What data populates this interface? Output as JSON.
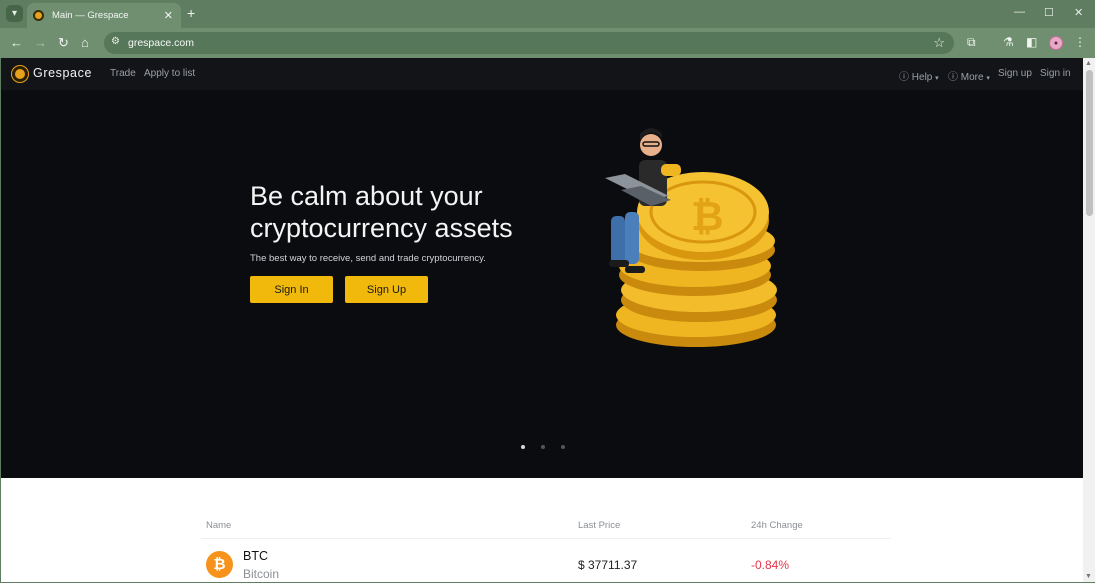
{
  "browser": {
    "tab_title": "Main — Grespace",
    "url": "grespace.com"
  },
  "site": {
    "logo_text": "Grespace",
    "nav_left": [
      "Trade",
      "Apply to list"
    ],
    "nav_right": {
      "help": "Help",
      "more": "More",
      "sign_up": "Sign up",
      "sign_in": "Sign in"
    }
  },
  "hero": {
    "title": "Be calm about your cryptocurrency assets",
    "subtitle": "The best way to receive, send and trade cryptocurrency.",
    "sign_in_button": "Sign In",
    "sign_up_button": "Sign Up",
    "carousel_active_index": 0,
    "carousel_count": 3
  },
  "market": {
    "headers": {
      "name": "Name",
      "last_price": "Last Price",
      "change": "24h Change"
    },
    "rows": [
      {
        "symbol": "BTC",
        "name": "Bitcoin",
        "price": "$ 37711.37",
        "change": "-0.84%",
        "icon": "bitcoin-icon"
      }
    ]
  },
  "colors": {
    "accent": "#f0b90b",
    "hero_bg": "#0b0c0f",
    "negative": "#e8344a",
    "browser_frame": "#6f8f70"
  }
}
